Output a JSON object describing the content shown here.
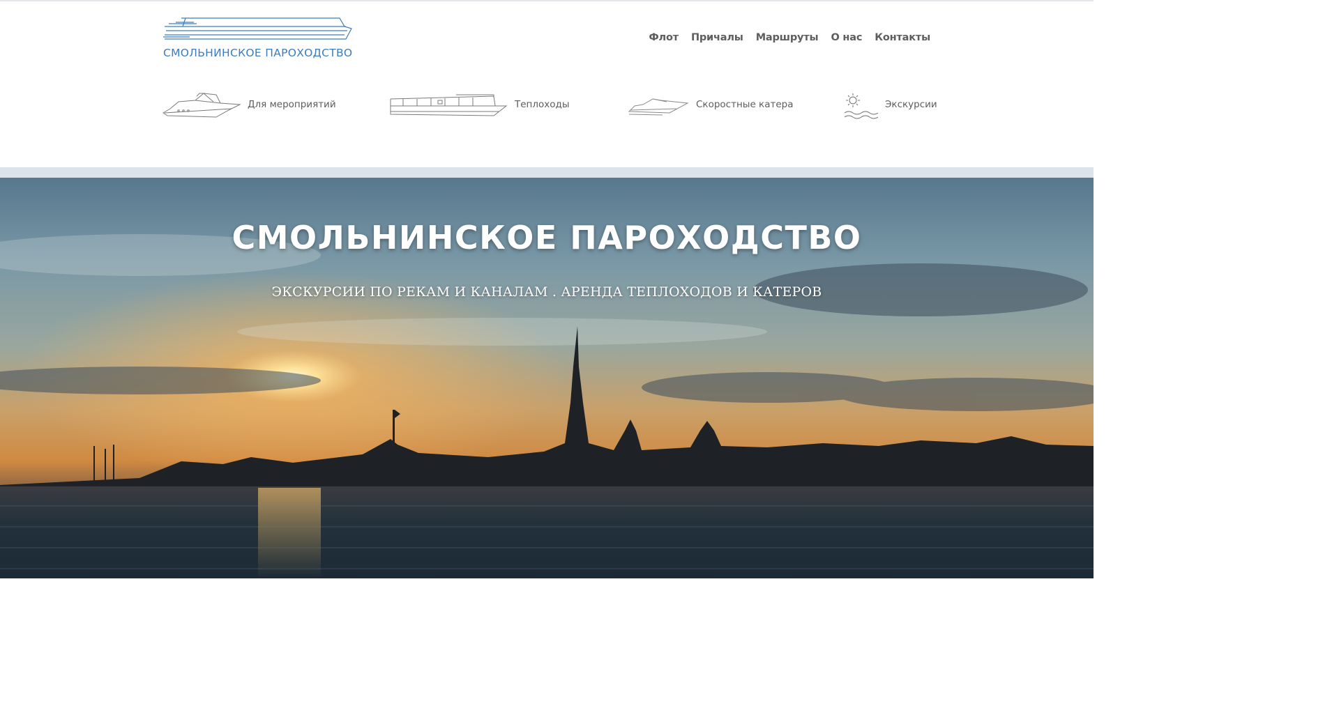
{
  "brand": {
    "name": "СМОЛЬНИНСКОЕ ПАРОХОДСТВО",
    "logo_icon": "ship-logo-icon",
    "color": "#3a7cc2"
  },
  "nav": {
    "items": [
      {
        "label": "Флот"
      },
      {
        "label": "Причалы"
      },
      {
        "label": "Маршруты"
      },
      {
        "label": "О нас"
      },
      {
        "label": "Контакты"
      }
    ]
  },
  "categories": [
    {
      "label": "Для мероприятий",
      "icon": "yacht-icon"
    },
    {
      "label": "Теплоходы",
      "icon": "riverboat-icon"
    },
    {
      "label": "Скоростные катера",
      "icon": "speedboat-icon"
    },
    {
      "label": "Экскурсии",
      "icon": "sun-waves-icon"
    }
  ],
  "hero": {
    "title": "СМОЛЬНИНСКОЕ ПАРОХОДСТВО",
    "subtitle": "ЭКСКУРСИИ ПО РЕКАМ И КАНАЛАМ . АРЕНДА ТЕПЛОХОДОВ И КАТЕРОВ",
    "image": "sunset-river-cityscape"
  },
  "colors": {
    "nav_text": "#5e5e5e",
    "category_text": "#5c5c5c",
    "hero_text": "#ffffff"
  }
}
